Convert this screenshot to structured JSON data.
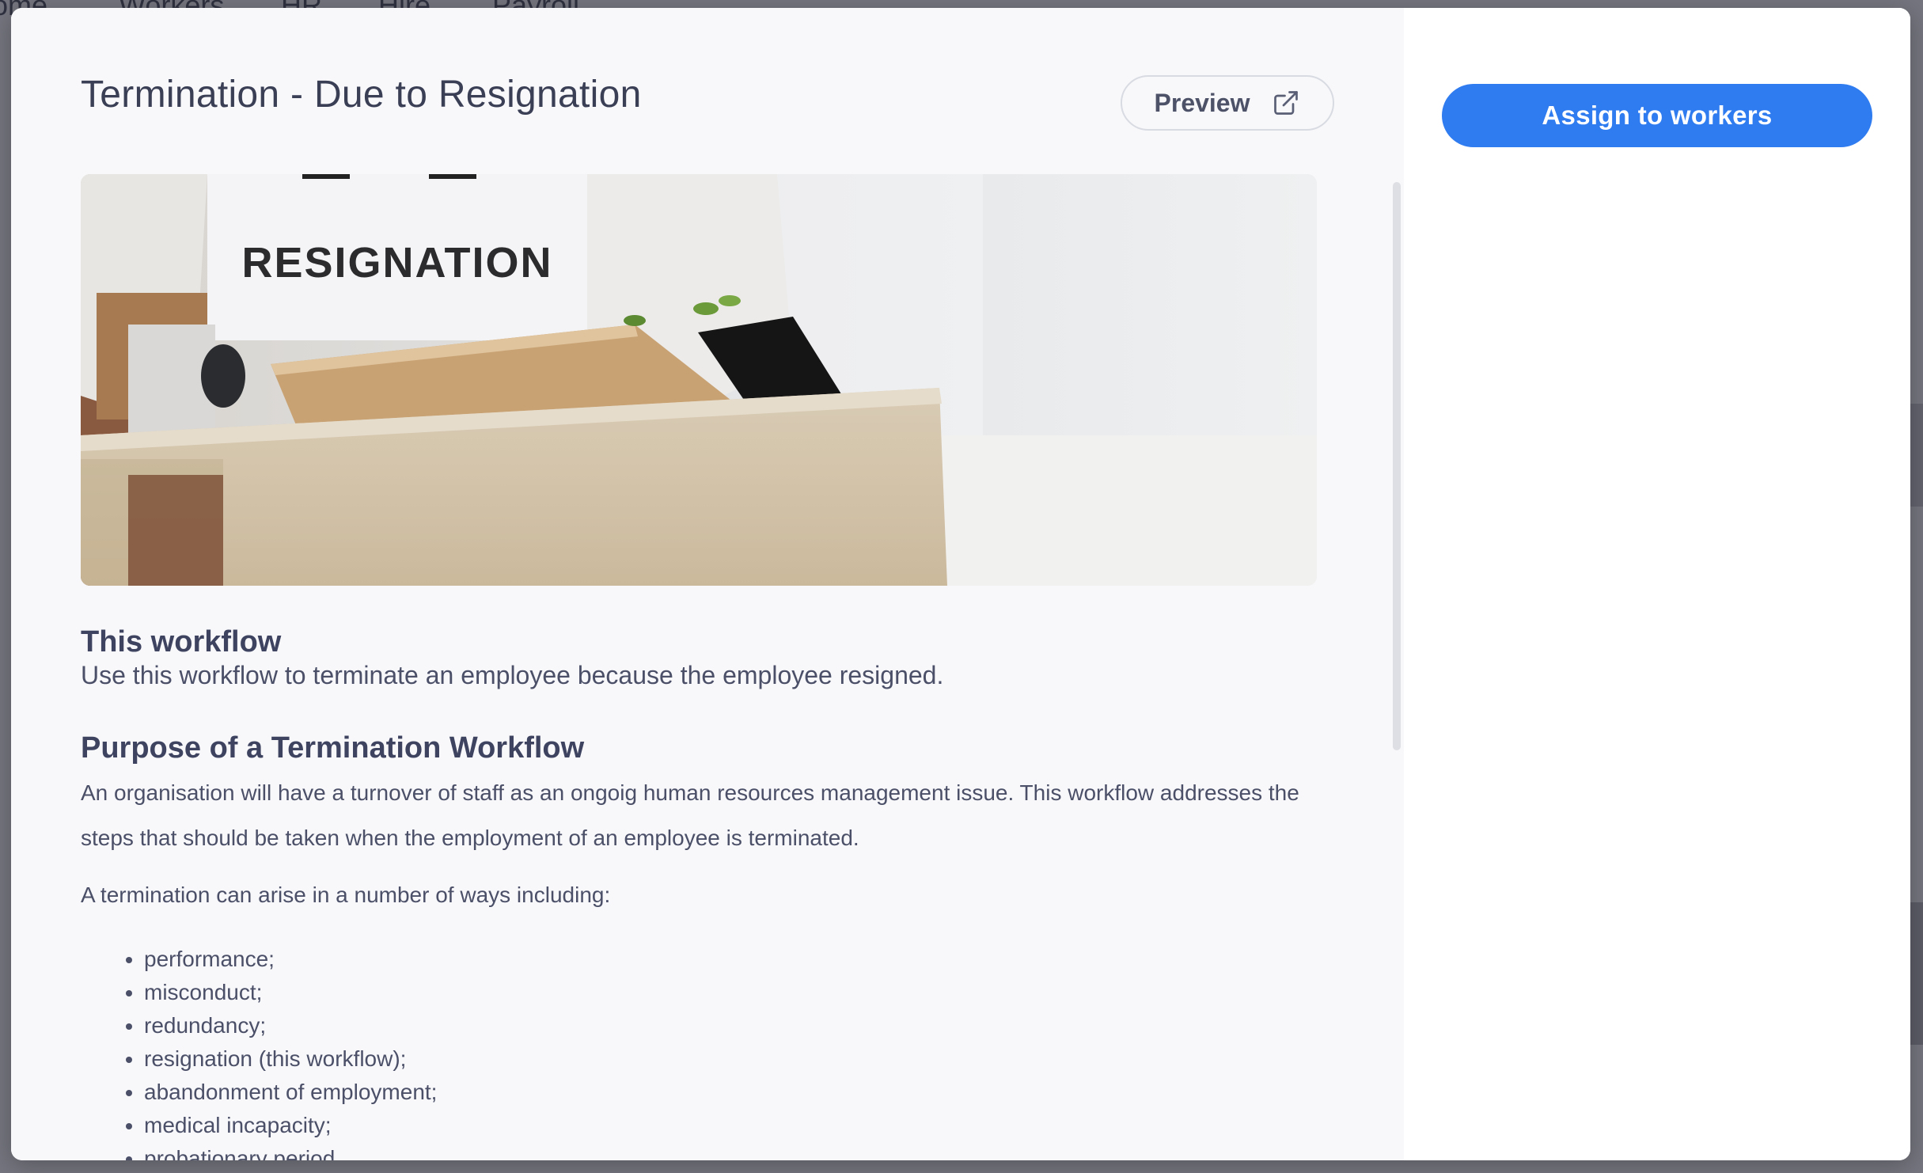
{
  "background_nav": {
    "items": [
      "ome",
      "Workers",
      "HR",
      "Hire",
      "Payroll"
    ]
  },
  "modal": {
    "title": "Termination - Due to Resignation",
    "preview_label": "Preview",
    "assign_label": "Assign to workers",
    "hero_sign_text": "RESIGNATION"
  },
  "content": {
    "section1_heading": "This workflow",
    "section1_text": "Use this workflow to terminate an employee because the employee resigned.",
    "section2_heading": "Purpose of a Termination Workflow",
    "section2_para": "An organisation will have a turnover of staff as an ongoig human resources management issue. This workflow addresses the steps that should be taken when the employment of an employee is terminated.",
    "section2_intro": "A termination can arise in a number of ways including:",
    "reasons": [
      "performance;",
      "misconduct;",
      "redundancy;",
      "resignation (this workflow);",
      "abandonment of employment;",
      "medical incapacity;",
      "probationary period"
    ]
  },
  "colors": {
    "accent": "#2f7bf0",
    "text": "#4b5068",
    "heading": "#3e4360"
  },
  "icons": {
    "preview": "external-link-icon",
    "close": "close-icon"
  }
}
